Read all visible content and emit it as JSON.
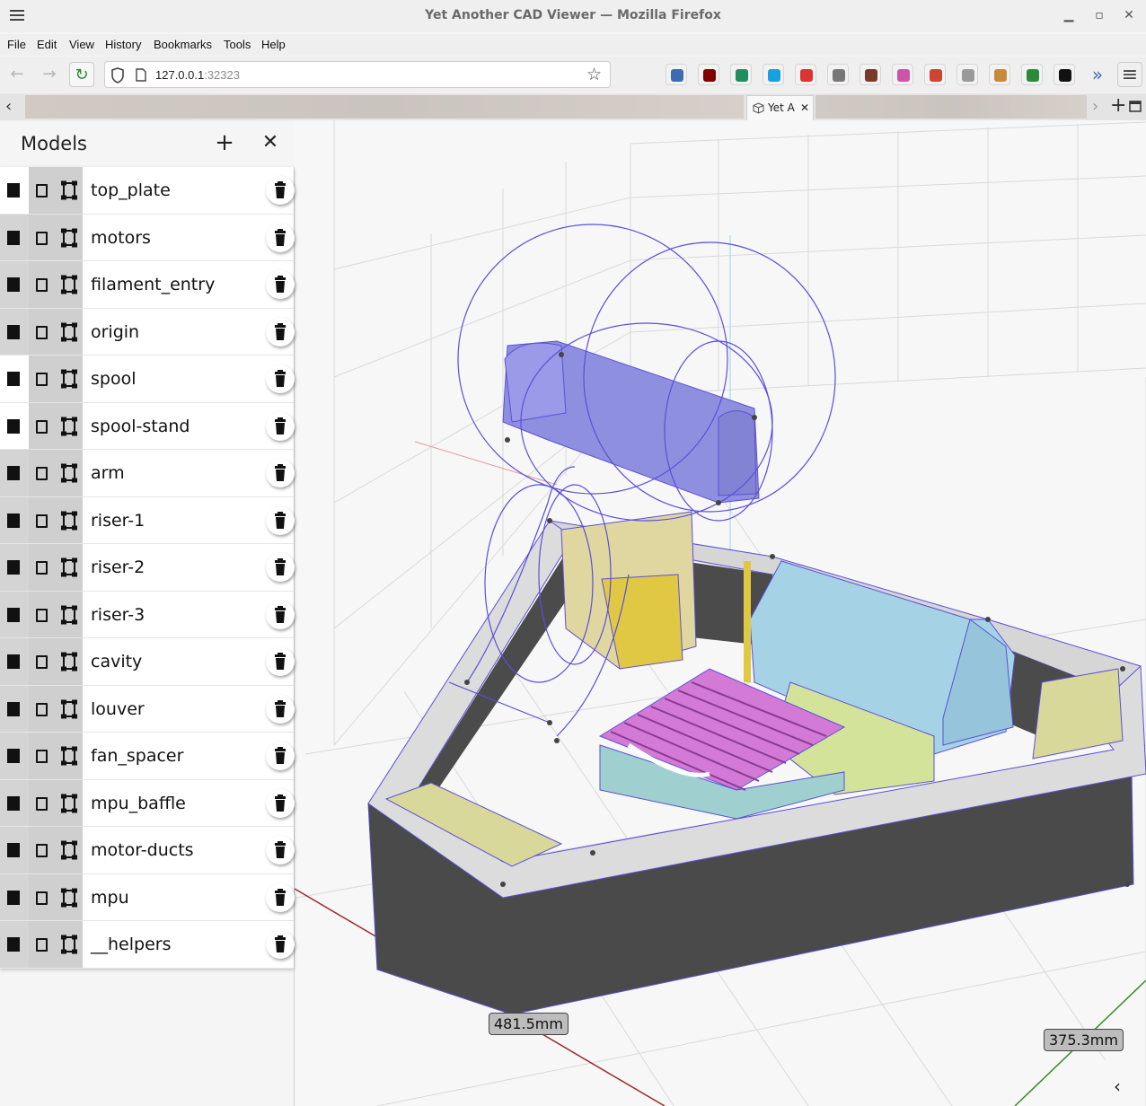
{
  "window": {
    "title": "Yet Another CAD Viewer — Mozilla Firefox",
    "minimize_glyph": "▁",
    "maximize_glyph": "▫",
    "close_glyph": "✕"
  },
  "menu": [
    {
      "label": "File"
    },
    {
      "label": "Edit"
    },
    {
      "label": "View"
    },
    {
      "label": "History"
    },
    {
      "label": "Bookmarks"
    },
    {
      "label": "Tools"
    },
    {
      "label": "Help"
    }
  ],
  "nav": {
    "url_host": "127.0.0.1",
    "url_port": ":32323",
    "back_glyph": "←",
    "forward_glyph": "→",
    "reload_glyph": "↻",
    "star_glyph": "☆",
    "overflow_glyph": "»",
    "menu_glyph": "≡"
  },
  "tabs": {
    "active_label": "Yet A",
    "active_close": "✕",
    "left_scroll": "‹",
    "right_scroll": "›",
    "new_tab": "+"
  },
  "extensions": [
    {
      "name": "download-icon",
      "color": "#3d6bb3"
    },
    {
      "name": "ublock-icon",
      "color": "#800000"
    },
    {
      "name": "save-icon",
      "color": "#1f8f5f"
    },
    {
      "name": "s-extension-icon",
      "color": "#1aa0e0"
    },
    {
      "name": "screen-blocked-icon",
      "color": "#d33"
    },
    {
      "name": "shoe-icon",
      "color": "#777"
    },
    {
      "name": "photo-icon",
      "color": "#7a3a2a"
    },
    {
      "name": "color-icon",
      "color": "#c5a"
    },
    {
      "name": "avatar-icon",
      "color": "#c43"
    },
    {
      "name": "cloud-icon",
      "color": "#999"
    },
    {
      "name": "cookie-icon",
      "color": "#c88a3a"
    },
    {
      "name": "puzzle-icon",
      "color": "#2c8a3a"
    },
    {
      "name": "block-icon",
      "color": "#111"
    }
  ],
  "panel": {
    "title": "Models",
    "add_glyph": "+",
    "close_glyph": "✕"
  },
  "models": [
    {
      "name": "top_plate",
      "white": true
    },
    {
      "name": "motors",
      "white": false
    },
    {
      "name": "filament_entry",
      "white": false
    },
    {
      "name": "origin",
      "white": false
    },
    {
      "name": "spool",
      "white": true
    },
    {
      "name": "spool-stand",
      "white": true
    },
    {
      "name": "arm",
      "white": false
    },
    {
      "name": "riser-1",
      "white": false
    },
    {
      "name": "riser-2",
      "white": false
    },
    {
      "name": "riser-3",
      "white": false
    },
    {
      "name": "cavity",
      "white": false
    },
    {
      "name": "louver",
      "white": false
    },
    {
      "name": "fan_spacer",
      "white": false
    },
    {
      "name": "mpu_baffle",
      "white": false
    },
    {
      "name": "motor-ducts",
      "white": false
    },
    {
      "name": "mpu",
      "white": false
    },
    {
      "name": "__helpers",
      "white": false
    }
  ],
  "dimensions": {
    "x_label": "481.5mm",
    "y_label": "375.3mm"
  },
  "colors": {
    "spool": "#8f8fe0",
    "filament_entry": "#d8d89a",
    "motors": "#e0c845",
    "mpu": "#a6d2e6",
    "louver": "#d27ad6",
    "cavity": "#9fd0cf",
    "frame_top": "#dcdcdc",
    "frame_side": "#4a4a4a",
    "edges": "#5a4fd8"
  },
  "collapse_glyph": "‹"
}
